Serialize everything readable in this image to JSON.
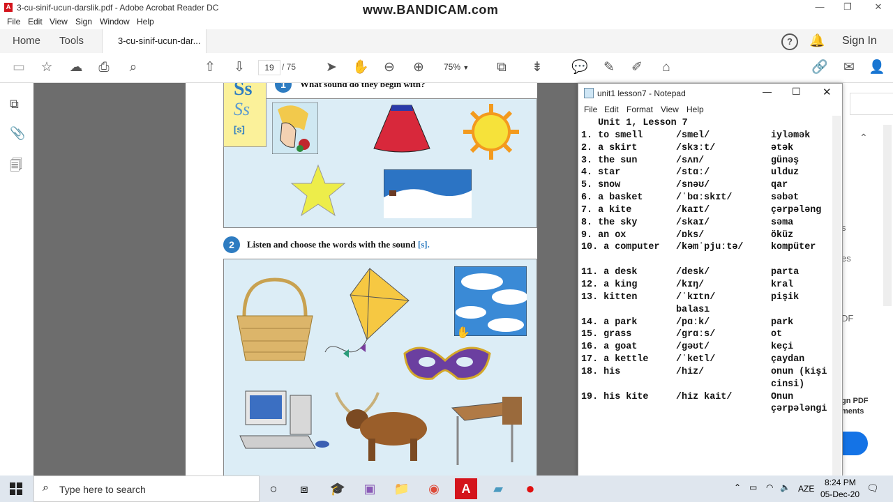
{
  "window_title": "3-cu-sinif-ucun-darslik.pdf - Adobe Acrobat Reader DC",
  "watermark": "www.BANDICAM.com",
  "menu": [
    "File",
    "Edit",
    "View",
    "Sign",
    "Window",
    "Help"
  ],
  "tabs": {
    "home": "Home",
    "tools": "Tools",
    "document": "3-cu-sinif-ucun-dar...",
    "sign_in": "Sign In"
  },
  "toolbar": {
    "page_current": "19",
    "page_total": "/ 75",
    "zoom": "75%"
  },
  "pdf": {
    "ss_big": "Ss",
    "ss_script": "Ss",
    "ss_phon": "[s]",
    "ex1_num": "1",
    "ex1_title": "What sound do they begin with?",
    "ex2_num": "2",
    "ex2_title_a": "Listen and choose the words with the sound ",
    "ex2_title_b": "[s]."
  },
  "right_pane": {
    "s": "s",
    "es": "es",
    "df": "DF",
    "sign_pdf": "gn PDF",
    "ments": "ments"
  },
  "notepad": {
    "title": "unit1 lesson7 - Notepad",
    "menu": [
      "File",
      "Edit",
      "Format",
      "View",
      "Help"
    ],
    "header": "   Unit 1, Lesson 7",
    "rows": [
      [
        "1. to smell",
        "/smel/",
        "iyləmək"
      ],
      [
        "2. a skirt",
        "/skɜːt/",
        "ətək"
      ],
      [
        "3. the sun",
        "/sʌn/",
        "günəş"
      ],
      [
        "4. star",
        "/stɑː/",
        "ulduz"
      ],
      [
        "5. snow",
        "/snəʊ/",
        "qar"
      ],
      [
        "6. a basket",
        "/ˈbɑːskɪt/",
        "səbət"
      ],
      [
        "7. a kite",
        "/kaɪt/",
        "çərpələng"
      ],
      [
        "8. the sky",
        "/skaɪ/",
        "səma"
      ],
      [
        "9. an ox",
        "/ɒks/",
        "öküz"
      ],
      [
        "10. a computer",
        "/kəmˈpjuːtə/",
        "kompüter"
      ],
      [
        "",
        "",
        ""
      ],
      [
        "11. a desk",
        "/desk/",
        "parta"
      ],
      [
        "12. a king",
        "/kɪŋ/",
        "kral"
      ],
      [
        "13. kitten",
        "/ˈkɪtn/",
        "pişik"
      ],
      [
        "",
        "balası",
        ""
      ],
      [
        "14. a park",
        "/pɑːk/",
        "park"
      ],
      [
        "15. grass",
        "/grɑːs/",
        "ot"
      ],
      [
        "16. a goat",
        "/gəʊt/",
        "keçi"
      ],
      [
        "17. a kettle",
        "/ˈketl/",
        "çaydan"
      ],
      [
        "18. his",
        "/hiz/",
        "onun (kişi"
      ],
      [
        "",
        "",
        "cinsi)"
      ],
      [
        "19. his kite",
        "/hiz kait/",
        "Onun"
      ],
      [
        "",
        "",
        "çərpələngi"
      ]
    ]
  },
  "taskbar": {
    "search_placeholder": "Type here to search",
    "lang": "AZE",
    "time": "8:24 PM",
    "date": "05-Dec-20"
  },
  "colors": {
    "accent_blue": "#2e7cc1",
    "pdf_red": "#d4141c",
    "panel_blue": "#dcedf6",
    "ss_yellow": "#fbf19a"
  }
}
